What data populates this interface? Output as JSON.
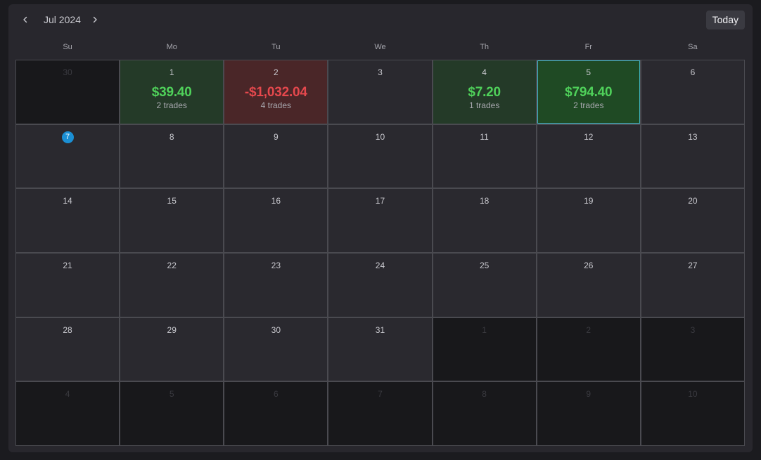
{
  "header": {
    "month_label": "Jul 2024",
    "today_label": "Today",
    "prev_icon": "chevron-left-icon",
    "next_icon": "chevron-right-icon"
  },
  "weekdays": [
    "Su",
    "Mo",
    "Tu",
    "We",
    "Th",
    "Fr",
    "Sa"
  ],
  "colors": {
    "profit": "#4fd15a",
    "loss": "#e5484d",
    "today_marker": "#1b8fd4",
    "selected_border": "#3fb7c4"
  },
  "days": [
    {
      "day": "30",
      "current_month": false
    },
    {
      "day": "1",
      "current_month": true,
      "pnl": "$39.40",
      "trades": "2 trades",
      "result": "win"
    },
    {
      "day": "2",
      "current_month": true,
      "pnl": "-$1,032.04",
      "trades": "4 trades",
      "result": "loss"
    },
    {
      "day": "3",
      "current_month": true
    },
    {
      "day": "4",
      "current_month": true,
      "pnl": "$7.20",
      "trades": "1 trades",
      "result": "win"
    },
    {
      "day": "5",
      "current_month": true,
      "pnl": "$794.40",
      "trades": "2 trades",
      "result": "win",
      "selected": true
    },
    {
      "day": "6",
      "current_month": true
    },
    {
      "day": "7",
      "current_month": true,
      "today": true
    },
    {
      "day": "8",
      "current_month": true
    },
    {
      "day": "9",
      "current_month": true
    },
    {
      "day": "10",
      "current_month": true
    },
    {
      "day": "11",
      "current_month": true
    },
    {
      "day": "12",
      "current_month": true
    },
    {
      "day": "13",
      "current_month": true
    },
    {
      "day": "14",
      "current_month": true
    },
    {
      "day": "15",
      "current_month": true
    },
    {
      "day": "16",
      "current_month": true
    },
    {
      "day": "17",
      "current_month": true
    },
    {
      "day": "18",
      "current_month": true
    },
    {
      "day": "19",
      "current_month": true
    },
    {
      "day": "20",
      "current_month": true
    },
    {
      "day": "21",
      "current_month": true
    },
    {
      "day": "22",
      "current_month": true
    },
    {
      "day": "23",
      "current_month": true
    },
    {
      "day": "24",
      "current_month": true
    },
    {
      "day": "25",
      "current_month": true
    },
    {
      "day": "26",
      "current_month": true
    },
    {
      "day": "27",
      "current_month": true
    },
    {
      "day": "28",
      "current_month": true
    },
    {
      "day": "29",
      "current_month": true
    },
    {
      "day": "30",
      "current_month": true
    },
    {
      "day": "31",
      "current_month": true
    },
    {
      "day": "1",
      "current_month": false
    },
    {
      "day": "2",
      "current_month": false
    },
    {
      "day": "3",
      "current_month": false
    },
    {
      "day": "4",
      "current_month": false
    },
    {
      "day": "5",
      "current_month": false
    },
    {
      "day": "6",
      "current_month": false
    },
    {
      "day": "7",
      "current_month": false
    },
    {
      "day": "8",
      "current_month": false
    },
    {
      "day": "9",
      "current_month": false
    },
    {
      "day": "10",
      "current_month": false
    }
  ]
}
